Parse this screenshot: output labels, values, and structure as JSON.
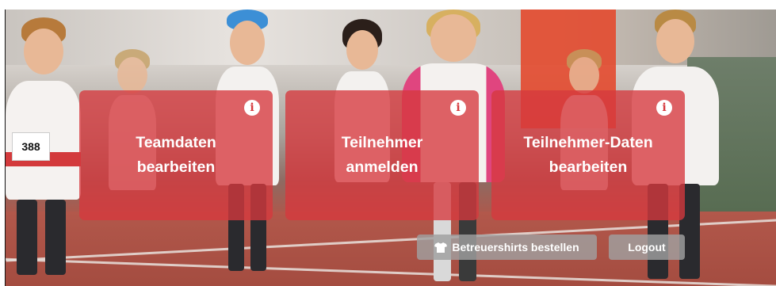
{
  "tiles": [
    {
      "line1": "Teamdaten",
      "line2": "bearbeiten",
      "info": "i"
    },
    {
      "line1": "Teilnehmer",
      "line2": "anmelden",
      "info": "i"
    },
    {
      "line1": "Teilnehmer-Daten",
      "line2": "bearbeiten",
      "info": "i"
    }
  ],
  "bib_number": "388",
  "actions": {
    "shirts_label": "Betreuershirts bestellen",
    "logout_label": "Logout"
  },
  "colors": {
    "tile": "#d6393d",
    "button": "#a0a0a0",
    "track": "#b0574a"
  },
  "icons": [
    "info-icon",
    "tshirt-icon"
  ]
}
